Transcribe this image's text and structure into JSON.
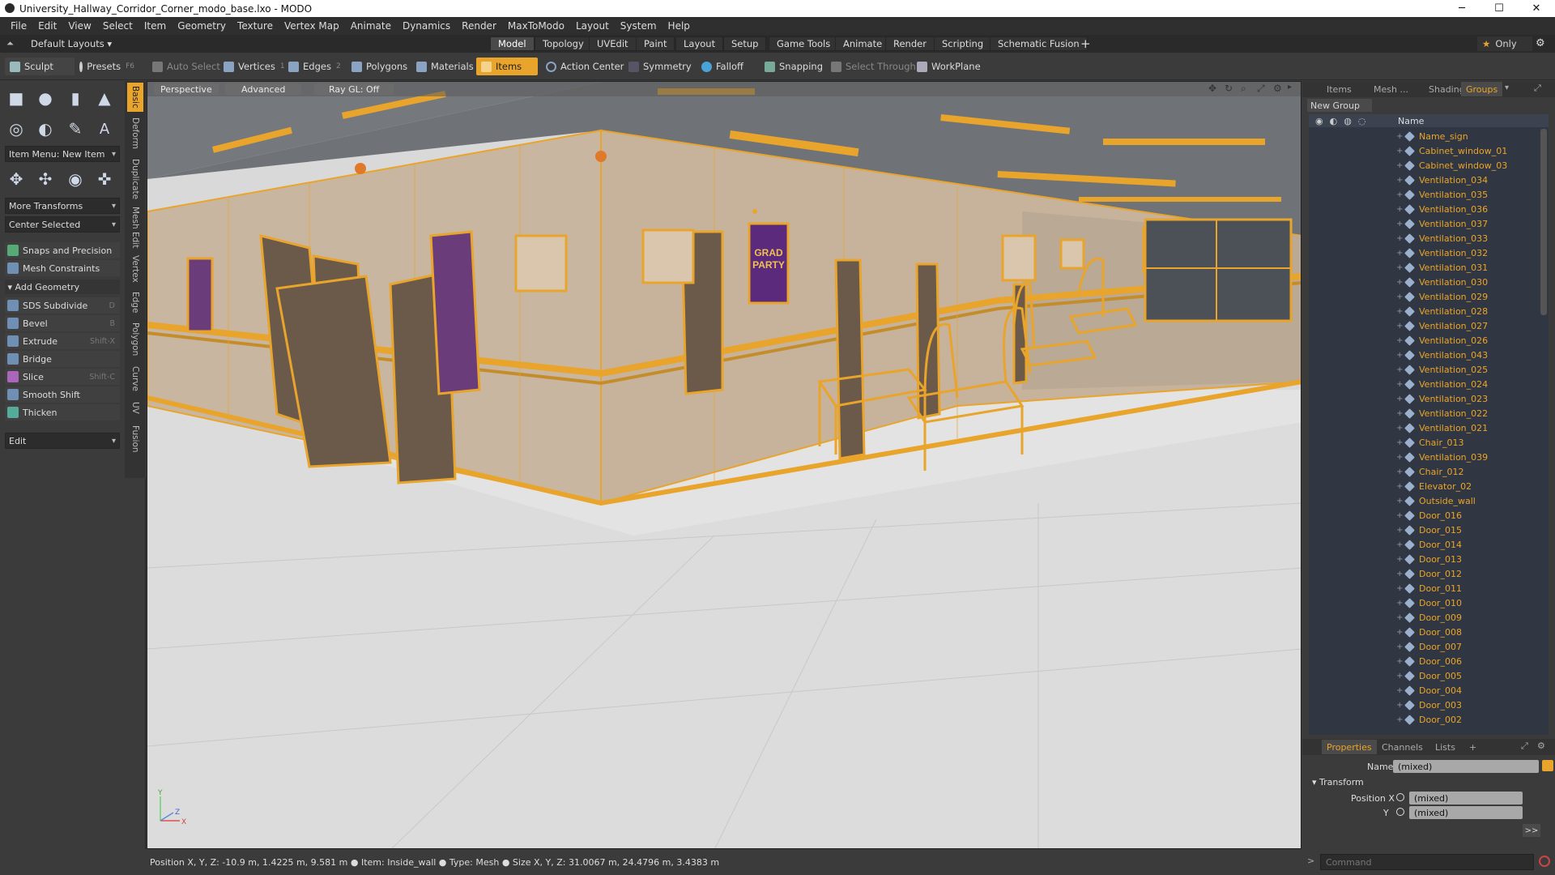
{
  "window": {
    "title": "University_Hallway_Corridor_Corner_modo_base.lxo - MODO",
    "min": "─",
    "max": "☐",
    "close": "✕"
  },
  "menubar": [
    "File",
    "Edit",
    "View",
    "Select",
    "Item",
    "Geometry",
    "Texture",
    "Vertex Map",
    "Animate",
    "Dynamics",
    "Render",
    "MaxToModo",
    "Layout",
    "System",
    "Help"
  ],
  "layoutbar": {
    "layouts_label": "Default Layouts",
    "tabs": [
      "Model",
      "Topology",
      "UVEdit",
      "Paint",
      "Layout",
      "Setup",
      "Game Tools",
      "Animate",
      "Render",
      "Scripting",
      "Schematic Fusion"
    ],
    "active_tab": "Model",
    "add": "+",
    "only_label": "Only",
    "star": "★"
  },
  "toolbar": {
    "sculpt": "Sculpt",
    "presets": "Presets",
    "presets_key": "F6",
    "auto_select": "Auto Select",
    "vertices": "Vertices",
    "vertices_key": "1",
    "edges": "Edges",
    "edges_key": "2",
    "polygons": "Polygons",
    "materials": "Materials",
    "items": "Items",
    "action_center": "Action Center",
    "symmetry": "Symmetry",
    "falloff": "Falloff",
    "snapping": "Snapping",
    "select_through": "Select Through",
    "workplane": "WorkPlane"
  },
  "leftpanel": {
    "vtabs": [
      "Basic",
      "Deform",
      "Duplicate",
      "Mesh Edit",
      "Vertex",
      "Edge",
      "Polygon",
      "Curve",
      "UV",
      "Fusion"
    ],
    "item_menu": "Item Menu: New Item",
    "more_transforms": "More Transforms",
    "center_selected": "Center Selected",
    "snaps": "Snaps and Precision",
    "mesh_constraints": "Mesh Constraints",
    "add_geometry": "Add Geometry",
    "tools": [
      {
        "label": "SDS Subdivide",
        "key": "D"
      },
      {
        "label": "Bevel",
        "key": "B"
      },
      {
        "label": "Extrude",
        "key": "Shift-X"
      },
      {
        "label": "Bridge",
        "key": ""
      },
      {
        "label": "Slice",
        "key": "Shift-C"
      },
      {
        "label": "Smooth Shift",
        "key": ""
      },
      {
        "label": "Thicken",
        "key": ""
      }
    ],
    "edit": "Edit"
  },
  "viewport": {
    "perspective": "Perspective",
    "advanced": "Advanced",
    "raygl": "Ray GL: Off",
    "poster_line1": "GRAD",
    "poster_line2": "PARTY",
    "axis_y": "Y",
    "axis_x": "X",
    "axis_z": "Z"
  },
  "rightpanel": {
    "tabs": [
      "Items",
      "Mesh ...",
      "Shading",
      "Groups"
    ],
    "active_tab": "Groups",
    "new_group": "New Group",
    "name_header": "Name",
    "groups": [
      "Name_sign",
      "Cabinet_window_01",
      "Cabinet_window_03",
      "Ventilation_034",
      "Ventilation_035",
      "Ventilation_036",
      "Ventilation_037",
      "Ventilation_033",
      "Ventilation_032",
      "Ventilation_031",
      "Ventilation_030",
      "Ventilation_029",
      "Ventilation_028",
      "Ventilation_027",
      "Ventilation_026",
      "Ventilation_043",
      "Ventilation_025",
      "Ventilation_024",
      "Ventilation_023",
      "Ventilation_022",
      "Ventilation_021",
      "Chair_013",
      "Ventilation_039",
      "Chair_012",
      "Elevator_02",
      "Outside_wall",
      "Door_016",
      "Door_015",
      "Door_014",
      "Door_013",
      "Door_012",
      "Door_011",
      "Door_010",
      "Door_009",
      "Door_008",
      "Door_007",
      "Door_006",
      "Door_005",
      "Door_004",
      "Door_003",
      "Door_002"
    ],
    "prop_tabs": [
      "Properties",
      "Channels",
      "Lists"
    ],
    "prop_add": "+",
    "name_label": "Name",
    "name_value": "(mixed)",
    "transform": "Transform",
    "position_x_label": "Position X",
    "position_y_label": "Y",
    "position_x_value": "(mixed)",
    "position_y_value": "(mixed)",
    "more": ">>"
  },
  "statusbar": {
    "text": "Position X, Y, Z:  -10.9 m, 1.4225 m, 9.581 m ● Item:  Inside_wall ● Type:  Mesh ● Size X, Y, Z:   31.0067 m, 24.4796 m, 3.4383 m"
  },
  "command": {
    "placeholder": "Command",
    "prompt": ">"
  }
}
